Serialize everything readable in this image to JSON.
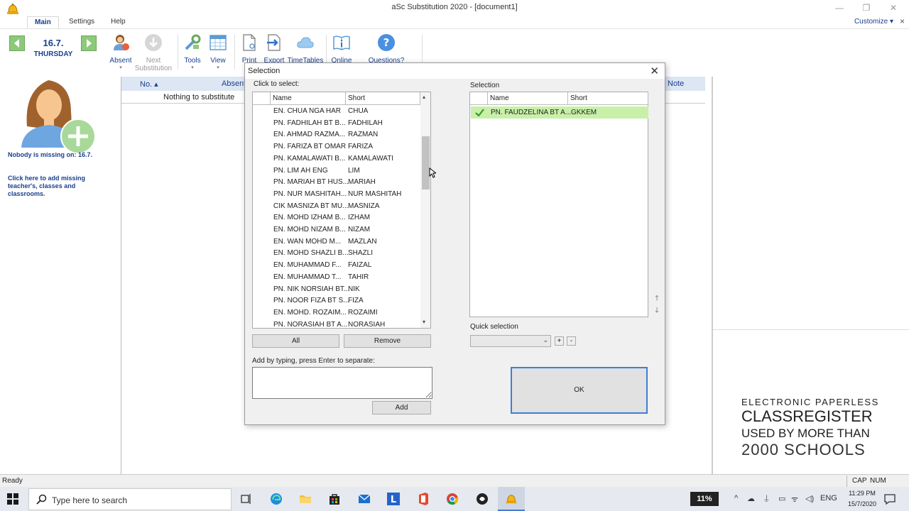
{
  "window": {
    "title": "aSc Substitution 2020 - [document1]",
    "controls": [
      "—",
      "❐",
      "✕"
    ]
  },
  "menu": {
    "tabs": [
      "Main",
      "Settings",
      "Help"
    ],
    "customize": "Customize",
    "customize_chev": "▾",
    "close": "×"
  },
  "ribbon": {
    "date": "16.7.",
    "day": "THURSDAY",
    "absent": "Absent",
    "next_line1": "Next",
    "next_line2": "Substitution",
    "tools": "Tools",
    "view": "View",
    "print": "Print",
    "export": "Export",
    "timetables": "TimeTables",
    "online": "Online",
    "questions": "Questions?",
    "drop_arrow": "▾"
  },
  "left_panel": {
    "missing": "Nobody is missing on: 16.7.",
    "add_missing": "Click here to add missing teacher's, classes and classrooms."
  },
  "grid": {
    "col_no": "No. ▴",
    "col_absent": "Absent",
    "col_note": "Note",
    "nothing": "Nothing to substitute"
  },
  "promo": {
    "line1": "ELECTRONIC PAPERLESS",
    "line2": "CLASSREGISTER",
    "line3": "USED BY MORE THAN",
    "line4": "2000 SCHOOLS"
  },
  "status": {
    "ready": "Ready",
    "cap": "CAP",
    "num": "NUM"
  },
  "taskbar": {
    "search_placeholder": "Type here to search",
    "battery": "11%",
    "lang": "ENG",
    "time": "11:29 PM",
    "date": "15/7/2020"
  },
  "dialog": {
    "title": "Selection",
    "close": "✕",
    "click_label": "Click to select:",
    "col_name": "Name",
    "col_short": "Short",
    "rows": [
      {
        "name": "EN. CHUA NGA  HAR",
        "short": "CHUA"
      },
      {
        "name": "PN. FADHILAH BT B...",
        "short": "FADHILAH"
      },
      {
        "name": "EN. AHMAD RAZMA...",
        "short": "RAZMAN"
      },
      {
        "name": "PN. FARIZA BT OMAR",
        "short": "FARIZA"
      },
      {
        "name": "PN. KAMALAWATI B...",
        "short": "KAMALAWATI"
      },
      {
        "name": "PN. LIM AH ENG",
        "short": "LIM"
      },
      {
        "name": "PN. MARIAH BT HUS...",
        "short": "MARIAH"
      },
      {
        "name": "PN. NUR MASHITAH...",
        "short": "NUR MASHITAH"
      },
      {
        "name": "CIK MASNIZA BT MU...",
        "short": "MASNIZA"
      },
      {
        "name": "EN. MOHD IZHAM B...",
        "short": "IZHAM"
      },
      {
        "name": "EN. MOHD NIZAM B...",
        "short": "NIZAM"
      },
      {
        "name": "EN. WAN MOHD M...",
        "short": "MAZLAN"
      },
      {
        "name": "EN. MOHD SHAZLI B...",
        "short": "SHAZLI"
      },
      {
        "name": "EN. MUHAMMAD F...",
        "short": "FAIZAL"
      },
      {
        "name": "EN. MUHAMMAD T...",
        "short": "TAHIR"
      },
      {
        "name": "PN. NIK NORSIAH BT...",
        "short": "NIK"
      },
      {
        "name": "PN. NOOR FIZA BT S...",
        "short": "FIZA"
      },
      {
        "name": "EN. MOHD. ROZAIM...",
        "short": "ROZAIMI"
      },
      {
        "name": "PN. NORASIAH BT A...",
        "short": "NORASIAH"
      }
    ],
    "scroll_up": "▴",
    "scroll_down": "▾",
    "all_button": "All",
    "remove_button": "Remove",
    "type_label": "Add by typing, press Enter to separate:",
    "add_button": "Add",
    "selection_label": "Selection",
    "selected": {
      "name": "PN. FAUDZELINA BT A...",
      "short": "GKKEM"
    },
    "move_up": "🡑",
    "move_down": "🡓",
    "quick_label": "Quick selection",
    "quick_value": "",
    "quick_chev": "⌄",
    "plus": "+",
    "minus": "-",
    "ok_button": "OK"
  },
  "colors": {
    "accent": "#1a3f8f",
    "selected_row": "#c8f0a8",
    "ok_border": "#3c7fd6"
  }
}
